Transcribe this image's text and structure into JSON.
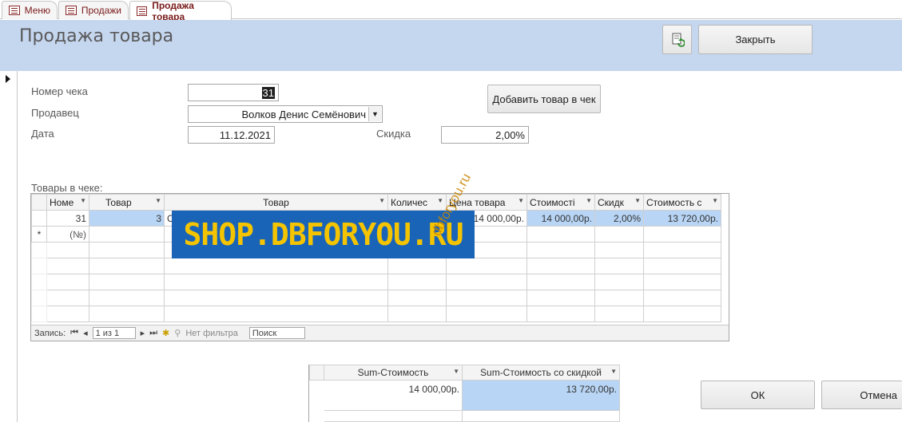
{
  "tabs": [
    {
      "label": "Меню"
    },
    {
      "label": "Продажи"
    },
    {
      "label": "Продажа товара"
    }
  ],
  "header": {
    "title": "Продажа товара",
    "close_label": "Закрыть"
  },
  "form": {
    "receipt_label": "Номер чека",
    "receipt_value": "31",
    "seller_label": "Продавец",
    "seller_value": "Волков Денис Семёнович",
    "date_label": "Дата",
    "date_value": "11.12.2021",
    "discount_label": "Скидка",
    "discount_value": "2,00%",
    "add_item_label": "Добавить товар в чек"
  },
  "items": {
    "caption": "Товары в чеке:",
    "columns": [
      "Номе",
      "Товар",
      "Товар",
      "Количес",
      "Цена товара",
      "Стоимості",
      "Скидк",
      "Стоимость с"
    ],
    "row": [
      "31",
      "3",
      "С",
      "",
      "14 000,00р.",
      "14 000,00р.",
      "2,00%",
      "13 720,00р."
    ],
    "new_row_marker": "*",
    "new_row_value": "(№)",
    "nav": {
      "record_label": "Запись:",
      "position": "1 из 1",
      "filter_label": "Нет фильтра",
      "search_label": "Поиск"
    }
  },
  "summary": {
    "columns": [
      "Sum-Стоимость",
      "Sum-Стоимость со скидкой"
    ],
    "values": [
      "14 000,00р.",
      "13 720,00р."
    ]
  },
  "buttons": {
    "ok_label": "ОК",
    "cancel_label": "Отмена"
  },
  "watermark": {
    "banner": "SHOP.DBFORYOU.RU",
    "diagonal": "dbforyou.ru"
  }
}
